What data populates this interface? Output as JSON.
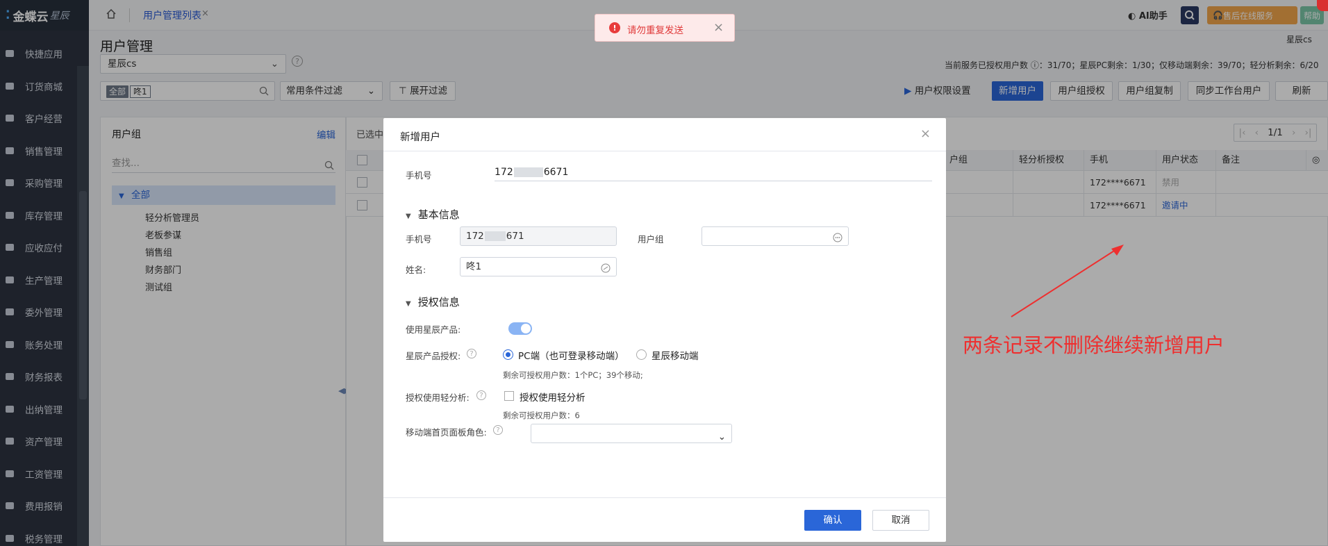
{
  "app": {
    "logo_text": "金蝶云",
    "logo_sub": "星辰"
  },
  "sidebar": {
    "items": [
      {
        "label": "快捷应用",
        "icon": "grid-icon"
      },
      {
        "label": "订货商城",
        "icon": "shop-bag-icon"
      },
      {
        "label": "客户经营",
        "icon": "customer-icon"
      },
      {
        "label": "销售管理",
        "icon": "sales-chart-icon"
      },
      {
        "label": "采购管理",
        "icon": "cart-icon"
      },
      {
        "label": "库存管理",
        "icon": "box-icon"
      },
      {
        "label": "应收应付",
        "icon": "receivable-icon"
      },
      {
        "label": "生产管理",
        "icon": "factory-icon"
      },
      {
        "label": "委外管理",
        "icon": "outsource-icon"
      },
      {
        "label": "账务处理",
        "icon": "ledger-icon"
      },
      {
        "label": "财务报表",
        "icon": "report-icon"
      },
      {
        "label": "出纳管理",
        "icon": "cashier-icon"
      },
      {
        "label": "资产管理",
        "icon": "asset-icon"
      },
      {
        "label": "工资管理",
        "icon": "salary-icon"
      },
      {
        "label": "费用报销",
        "icon": "expense-icon"
      },
      {
        "label": "税务管理",
        "icon": "tax-icon"
      }
    ]
  },
  "topbar": {
    "tab_title": "用户管理列表",
    "tab_close": "×",
    "ai_label": "AI助手",
    "service_label": "售后在线服务",
    "help_label": "帮助"
  },
  "page": {
    "title": "用户管理",
    "org_select": "星辰cs",
    "org_right": "星辰cs",
    "license_info": "当前服务已授权用户数 ⓘ：31/70；星辰PC剩余：1/30；仅移动端剩余：39/70；轻分析剩余：6/20",
    "filter_all": "全部",
    "filter_value": "咚1",
    "cond_filter": "常用条件过滤",
    "expand_filter": "展开过滤",
    "perm_setting": "用户权限设置",
    "buttons": {
      "add_user": "新增用户",
      "group_auth": "用户组授权",
      "group_copy": "用户组复制",
      "sync_workbench": "同步工作台用户",
      "refresh": "刷新"
    }
  },
  "groups": {
    "title": "用户组",
    "edit": "编辑",
    "search_placeholder": "查找...",
    "all": "全部",
    "children": [
      "轻分析管理员",
      "老板参谋",
      "销售组",
      "财务部门",
      "测试组"
    ]
  },
  "table": {
    "selected_label": "已选中",
    "pager": {
      "page": "1/1"
    },
    "columns": [
      "户组",
      "轻分析授权",
      "手机",
      "用户状态",
      "备注"
    ],
    "rows": [
      {
        "phone": "172****6671",
        "status": "禁用",
        "status_color": "#aaaaaa"
      },
      {
        "phone": "172****6671",
        "status": "邀请中",
        "status_color": "#2a66d8"
      }
    ]
  },
  "toast": {
    "message": "请勿重复发送"
  },
  "modal": {
    "title": "新增用户",
    "phone_label": "手机号",
    "phone_head": "172",
    "phone_tail": "6671",
    "basic_section": "基本信息",
    "basic_phone_label": "手机号",
    "basic_phone_head": "172",
    "basic_phone_tail": "671",
    "user_group_label": "用户组",
    "name_label": "姓名:",
    "name_value": "咚1",
    "auth_section": "授权信息",
    "use_product_label": "使用星辰产品:",
    "product_auth_label": "星辰产品授权:",
    "pc_option": "PC端（也可登录移动端）",
    "mobile_option": "星辰移动端",
    "pc_remaining": "剩余可授权用户数：1个PC；39个移动;",
    "light_auth_label": "授权使用轻分析:",
    "light_option": "授权使用轻分析",
    "light_remaining": "剩余可授权用户数：6",
    "mobile_role_label": "移动端首页面板角色:",
    "confirm": "确认",
    "cancel": "取消"
  },
  "annotation": {
    "text": "两条记录不删除继续新增用户",
    "color": "#ee2f2f"
  }
}
